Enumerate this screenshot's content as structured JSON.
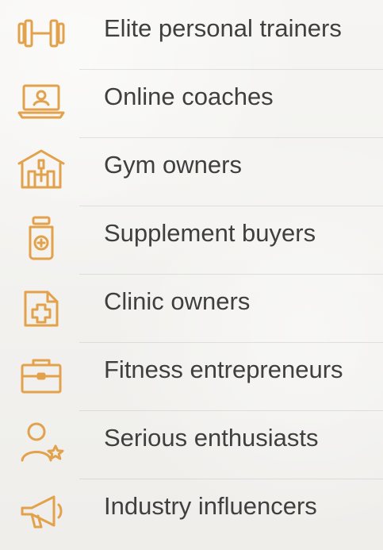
{
  "items": [
    {
      "label": "Elite personal trainers",
      "icon": "dumbbell-icon"
    },
    {
      "label": "Online coaches",
      "icon": "laptop-user-icon"
    },
    {
      "label": "Gym owners",
      "icon": "gym-building-icon"
    },
    {
      "label": "Supplement buyers",
      "icon": "supplement-jar-icon"
    },
    {
      "label": "Clinic owners",
      "icon": "medical-cross-icon"
    },
    {
      "label": "Fitness entrepreneurs",
      "icon": "briefcase-icon"
    },
    {
      "label": "Serious enthusiasts",
      "icon": "user-star-icon"
    },
    {
      "label": "Industry influencers",
      "icon": "megaphone-icon"
    }
  ],
  "colors": {
    "icon_accent": "#e2a14b",
    "text": "#3f3f3f",
    "background": "#f3f2f0"
  }
}
